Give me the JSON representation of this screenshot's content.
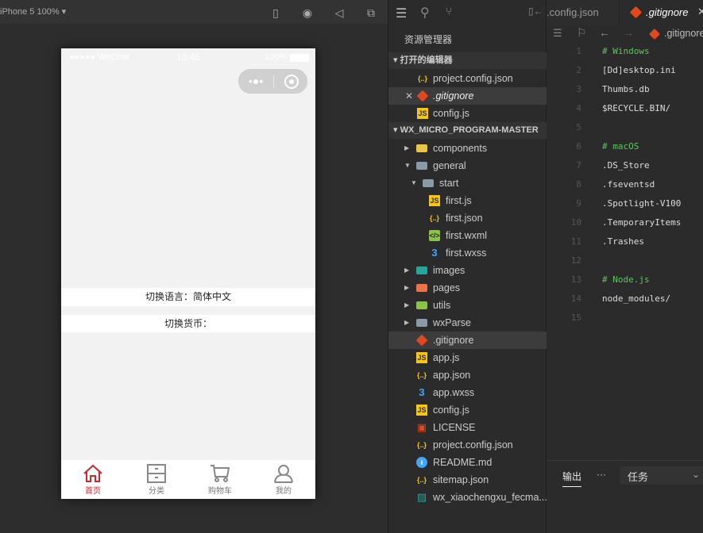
{
  "simulator": {
    "device": "iPhone 5 100% ▾",
    "status": {
      "signal": "●●●●● WeChat",
      "time": "13:45",
      "battery": "100%"
    },
    "rows": [
      {
        "label": "切换语言：简体中文"
      },
      {
        "label": "切换货币："
      }
    ],
    "tabs": [
      {
        "label": "首页",
        "icon": "home-icon"
      },
      {
        "label": "分类",
        "icon": "cabinet-icon"
      },
      {
        "label": "购物车",
        "icon": "cart-icon"
      },
      {
        "label": "我的",
        "icon": "user-icon"
      }
    ],
    "accent": "#c8282e"
  },
  "explorer": {
    "title": "资源管理器",
    "open_editors_label": "打开的编辑器",
    "project_label": "WX_MICRO_PROGRAM-MASTER",
    "open_editors": [
      {
        "name": "project.config.json",
        "type": "json"
      },
      {
        "name": ".gitignore",
        "type": "git"
      },
      {
        "name": "config.js",
        "type": "js"
      }
    ],
    "tree": [
      {
        "name": "components",
        "type": "folder",
        "level": 0,
        "arrow": "▶",
        "color": "#e8c547"
      },
      {
        "name": "general",
        "type": "folder",
        "level": 0,
        "arrow": "▼",
        "color": "#8a9aa8"
      },
      {
        "name": "start",
        "type": "folder",
        "level": 1,
        "arrow": "▼",
        "color": "#8a9aa8"
      },
      {
        "name": "first.js",
        "type": "js",
        "level": 2
      },
      {
        "name": "first.json",
        "type": "json",
        "level": 2
      },
      {
        "name": "first.wxml",
        "type": "wxml",
        "level": 2
      },
      {
        "name": "first.wxss",
        "type": "css",
        "level": 2
      },
      {
        "name": "images",
        "type": "folder",
        "level": 0,
        "arrow": "▶",
        "color": "#26a69a"
      },
      {
        "name": "pages",
        "type": "folder",
        "level": 0,
        "arrow": "▶",
        "color": "#ef7148"
      },
      {
        "name": "utils",
        "type": "folder",
        "level": 0,
        "arrow": "▶",
        "color": "#8bc34a"
      },
      {
        "name": "wxParse",
        "type": "folder",
        "level": 0,
        "arrow": "▶",
        "color": "#8a9aa8"
      },
      {
        "name": ".gitignore",
        "type": "git",
        "level": 0
      },
      {
        "name": "app.js",
        "type": "js",
        "level": 0
      },
      {
        "name": "app.json",
        "type": "json",
        "level": 0
      },
      {
        "name": "app.wxss",
        "type": "css",
        "level": 0
      },
      {
        "name": "config.js",
        "type": "js",
        "level": 0
      },
      {
        "name": "LICENSE",
        "type": "license",
        "level": 0
      },
      {
        "name": "project.config.json",
        "type": "json",
        "level": 0
      },
      {
        "name": "README.md",
        "type": "info",
        "level": 0
      },
      {
        "name": "sitemap.json",
        "type": "json",
        "level": 0
      },
      {
        "name": "wx_xiaochengxu_fecma...",
        "type": "image",
        "level": 0
      }
    ]
  },
  "editor": {
    "tabs": [
      {
        "label": ".config.json"
      },
      {
        "label": ".gitignore"
      }
    ],
    "breadcrumb": ".gitignore",
    "lines": [
      "# Windows",
      "[Dd]esktop.ini",
      "Thumbs.db",
      "$RECYCLE.BIN/",
      "",
      "# macOS",
      ".DS_Store",
      ".fseventsd",
      ".Spotlight-V100",
      ".TemporaryItems",
      ".Trashes",
      "",
      "# Node.js",
      "node_modules/",
      ""
    ],
    "panel": {
      "output_tab": "输出",
      "more": "···",
      "select": "任务"
    }
  }
}
